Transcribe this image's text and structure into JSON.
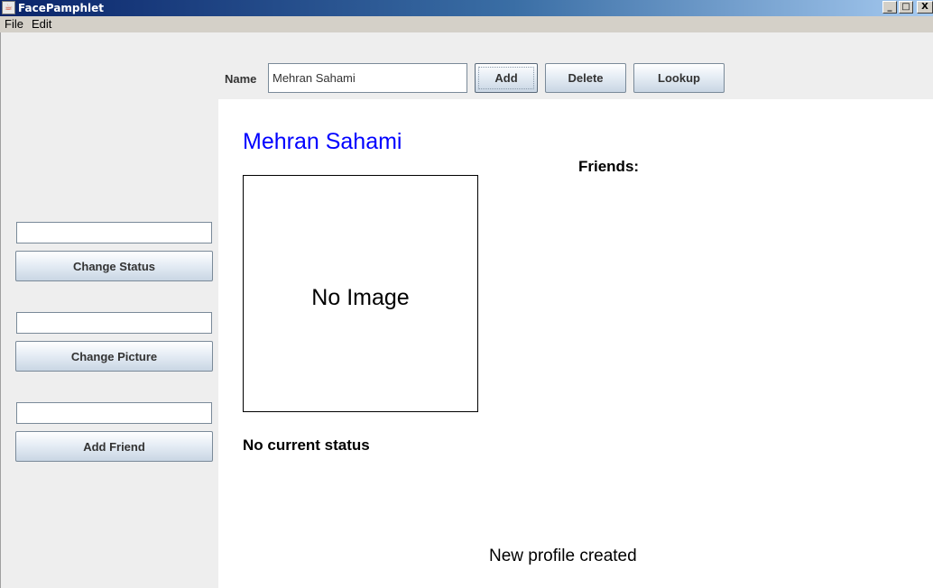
{
  "window": {
    "title": "FacePamphlet",
    "icon": "java-coffee-cup-icon",
    "controls": {
      "minimize": "_",
      "maximize": "□",
      "close": "X"
    }
  },
  "menu": {
    "items": [
      "File",
      "Edit"
    ]
  },
  "north": {
    "name_label": "Name",
    "name_value": "Mehran Sahami",
    "buttons": {
      "add": "Add",
      "delete": "Delete",
      "lookup": "Lookup"
    }
  },
  "west": {
    "status_field_value": "",
    "change_status": "Change Status",
    "picture_field_value": "",
    "change_picture": "Change Picture",
    "friend_field_value": "",
    "add_friend": "Add Friend"
  },
  "profile": {
    "name": "Mehran Sahami",
    "image_placeholder": "No Image",
    "status": "No current status",
    "friends_label": "Friends:"
  },
  "message": "New profile created",
  "colors": {
    "profile_name": "#0000ff",
    "panel_bg": "#eeeeee",
    "title_bar": "#0a246a"
  }
}
